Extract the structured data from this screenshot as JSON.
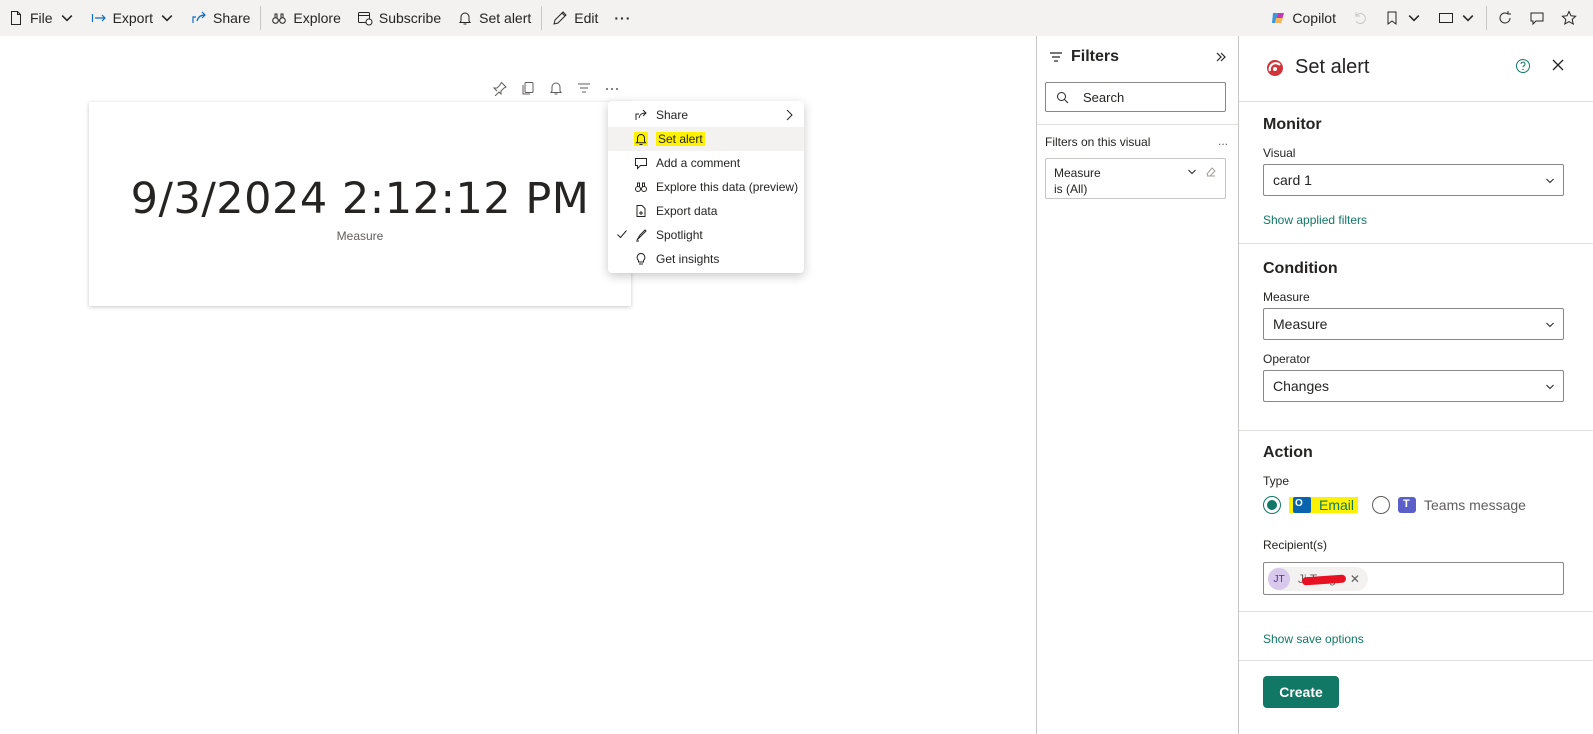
{
  "toolbar": {
    "file": "File",
    "export": "Export",
    "share": "Share",
    "explore": "Explore",
    "subscribe": "Subscribe",
    "set_alert": "Set alert",
    "edit": "Edit",
    "more": "···",
    "copilot": "Copilot"
  },
  "card": {
    "value": "9/3/2024 2:12:12 PM",
    "label": "Measure"
  },
  "context_menu": {
    "items": [
      {
        "label": "Share",
        "icon": "share-icon"
      },
      {
        "label": "Set alert",
        "icon": "bell-icon"
      },
      {
        "label": "Add a comment",
        "icon": "comment-icon"
      },
      {
        "label": "Explore this data (preview)",
        "icon": "binoculars-icon"
      },
      {
        "label": "Export data",
        "icon": "export-icon"
      },
      {
        "label": "Spotlight",
        "icon": "spotlight-icon"
      },
      {
        "label": "Get insights",
        "icon": "lightbulb-icon"
      }
    ]
  },
  "filters": {
    "title": "Filters",
    "search_placeholder": "Search",
    "section_title": "Filters on this visual",
    "more": "...",
    "filter_card": {
      "name": "Measure",
      "state": "is (All)"
    }
  },
  "set_alert": {
    "title": "Set alert",
    "monitor": {
      "heading": "Monitor",
      "visual_label": "Visual",
      "visual_value": "card 1",
      "link": "Show applied filters"
    },
    "condition": {
      "heading": "Condition",
      "measure_label": "Measure",
      "measure_value": "Measure",
      "operator_label": "Operator",
      "operator_value": "Changes"
    },
    "action": {
      "heading": "Action",
      "type_label": "Type",
      "email_label": "Email",
      "teams_label": "Teams message",
      "recipients_label": "Recipient(s)",
      "recipient_name": "Ji Tang",
      "selected_type": "Email"
    },
    "save_options_link": "Show save options",
    "create_button": "Create"
  },
  "colors": {
    "accent": "#117865",
    "highlight": "#fff200"
  }
}
